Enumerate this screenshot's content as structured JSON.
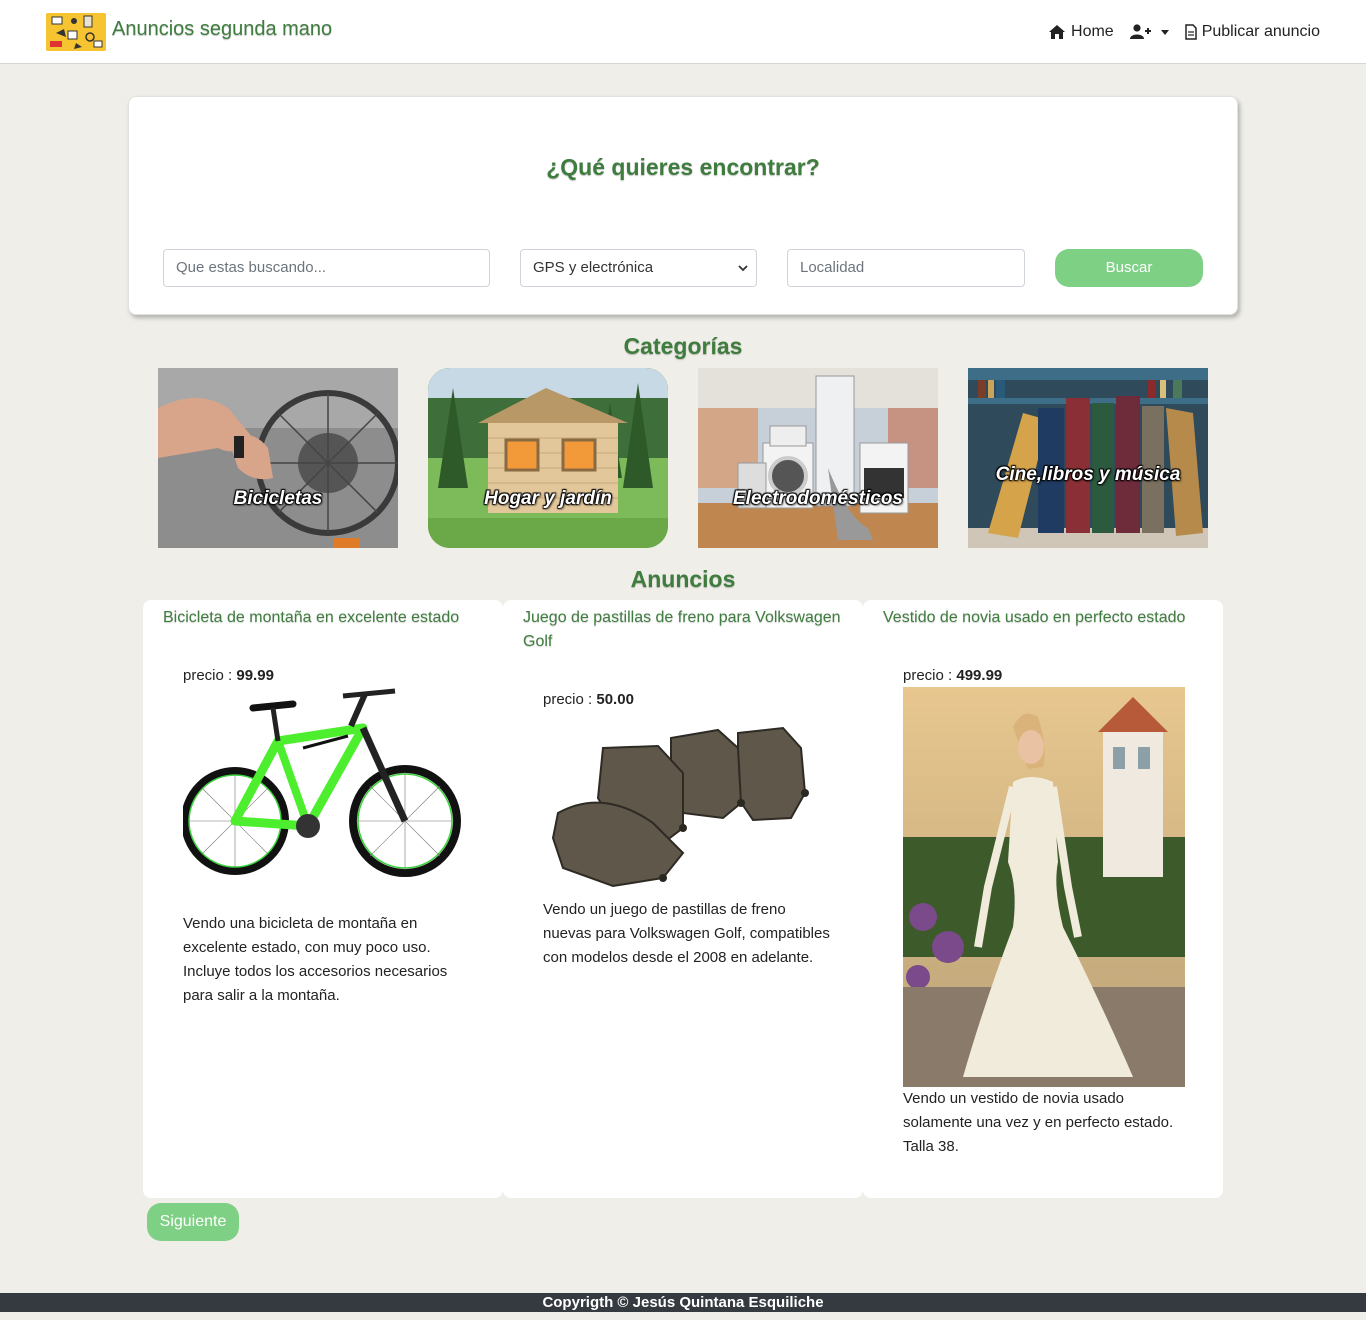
{
  "navbar": {
    "brand_title": "Anuncios segunda mano",
    "home_label": "Home",
    "publish_label": "Publicar anuncio",
    "icons": [
      "logo-image",
      "home-icon",
      "user-plus-icon",
      "file-icon"
    ]
  },
  "search": {
    "title": "¿Qué quieres encontrar?",
    "query_placeholder": "Que estas buscando...",
    "category_selected": "GPS y electrónica",
    "location_placeholder": "Localidad",
    "button_label": "Buscar"
  },
  "categories": {
    "title": "Categorías",
    "items": [
      {
        "label": "Bicicletas"
      },
      {
        "label": "Hogar y jardín"
      },
      {
        "label": "Electrodomésticos"
      },
      {
        "label": "Cine,libros y música"
      }
    ]
  },
  "ads": {
    "title": "Anuncios",
    "price_label": "precio :",
    "items": [
      {
        "title": "Bicicleta de montaña en excelente estado",
        "price": "99.99",
        "description": "Vendo una bicicleta de montaña en excelente estado, con muy poco uso. Incluye todos los accesorios necesarios para salir a la montaña."
      },
      {
        "title": "Juego de pastillas de freno para Volkswagen Golf",
        "price": "50.00",
        "description": "Vendo un juego de pastillas de freno nuevas para Volkswagen Golf, compatibles con modelos desde el 2008 en adelante."
      },
      {
        "title": "Vestido de novia usado en perfecto estado",
        "price": "499.99",
        "description": "Vendo un vestido de novia usado solamente una vez y en perfecto estado. Talla 38."
      }
    ],
    "next_label": "Siguiente"
  },
  "footer": {
    "text": "Copyrigth © Jesús Quintana Esquiliche"
  },
  "colors": {
    "brand_green": "#3f7d3f",
    "button_green": "#7dd084",
    "page_bg": "#efeee8",
    "footer_bg": "#343a40"
  }
}
